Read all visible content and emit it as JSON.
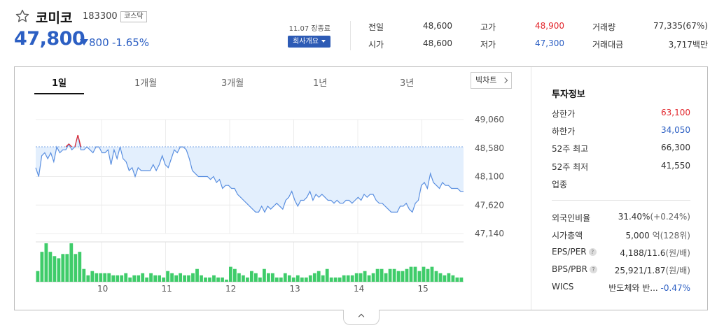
{
  "stock": {
    "name": "코미코",
    "code": "183300",
    "market": "코스닥",
    "price": "47,800",
    "change_amount": "800",
    "change_rate": "-1.65%",
    "date_close": "11.07 장종료",
    "company_button": "회사개요"
  },
  "quote": {
    "prev_close_label": "전일",
    "prev_close": "48,600",
    "high_label": "고가",
    "high": "48,900",
    "volume_label": "거래량",
    "volume": "77,335(67%)",
    "open_label": "시가",
    "open": "48,600",
    "low_label": "저가",
    "low": "47,300",
    "trade_value_label": "거래대금",
    "trade_value": "3,717백만"
  },
  "tabs": [
    {
      "label": "1일",
      "active": true
    },
    {
      "label": "1개월",
      "active": false
    },
    {
      "label": "3개월",
      "active": false
    },
    {
      "label": "1년",
      "active": false
    },
    {
      "label": "3년",
      "active": false
    }
  ],
  "big_chart_label": "빅차트",
  "colors": {
    "up": "#e2262c",
    "down": "#2c5fc3",
    "line": "#5a8fe0",
    "fill": "#e3effd",
    "volume": "#3fcc6a"
  },
  "chart_data": {
    "type": "area",
    "y_ticks": [
      "49,060",
      "48,580",
      "48,100",
      "47,620",
      "47,140"
    ],
    "ylim": [
      47140,
      49060
    ],
    "prev_close": 48600,
    "x_ticks": [
      "10",
      "11",
      "12",
      "13",
      "14",
      "15"
    ],
    "price_series": [
      48250,
      48100,
      48450,
      48500,
      48400,
      48500,
      48350,
      48600,
      48500,
      48550,
      48550,
      48650,
      48550,
      48600,
      48800,
      48550,
      48550,
      48600,
      48550,
      48500,
      48600,
      48600,
      48500,
      48500,
      48550,
      48300,
      48550,
      48400,
      48600,
      48400,
      48350,
      48200,
      48250,
      48100,
      48250,
      48200,
      48200,
      48200,
      48200,
      48300,
      48200,
      48300,
      48450,
      48300,
      48250,
      48400,
      48550,
      48500,
      48600,
      48600,
      48550,
      48400,
      48200,
      48150,
      48100,
      48100,
      48100,
      48100,
      48050,
      48100,
      48000,
      48050,
      47900,
      47950,
      47950,
      47900,
      47900,
      47800,
      47750,
      47700,
      47650,
      47600,
      47550,
      47500,
      47500,
      47600,
      47500,
      47600,
      47550,
      47600,
      47650,
      47600,
      47550,
      47700,
      47750,
      47850,
      47700,
      47600,
      47700,
      47700,
      47750,
      47850,
      47700,
      47800,
      47750,
      47800,
      47750,
      47700,
      47700,
      47650,
      47700,
      47650,
      47650,
      47700,
      47700,
      47650,
      47700,
      47750,
      47700,
      47800,
      47750,
      47800,
      47800,
      47700,
      47650,
      47650,
      47600,
      47550,
      47500,
      47500,
      47500,
      47600,
      47600,
      47650,
      47550,
      47500,
      47650,
      47700,
      47950,
      48000,
      47900,
      48150,
      48000,
      47950,
      47900,
      48000,
      47950,
      47950,
      47900,
      47900,
      47900,
      47850,
      47850
    ],
    "volume_series": [
      5,
      14,
      18,
      14,
      12,
      11,
      13,
      13,
      18,
      13,
      14,
      6,
      3,
      5,
      4,
      4,
      4,
      4,
      3,
      3,
      3,
      4,
      2,
      3,
      3,
      4,
      2,
      4,
      3,
      3,
      2,
      5,
      4,
      3,
      4,
      3,
      3,
      4,
      6,
      3,
      2,
      2,
      3,
      2,
      2,
      1,
      7,
      6,
      4,
      3,
      2,
      5,
      4,
      2,
      6,
      4,
      4,
      2,
      2,
      4,
      3,
      2,
      3,
      2,
      2,
      3,
      4,
      5,
      3,
      6,
      2,
      2,
      2,
      3,
      3,
      3,
      4,
      4,
      5,
      3,
      4,
      6,
      6,
      4,
      6,
      6,
      5,
      5,
      6,
      7,
      7,
      5,
      7,
      6,
      7,
      5,
      4,
      3,
      4,
      3,
      2,
      2
    ]
  },
  "investment": {
    "title": "투자정보",
    "upper_limit_label": "상한가",
    "upper_limit": "63,100",
    "lower_limit_label": "하한가",
    "lower_limit": "34,050",
    "week52_high_label": "52주 최고",
    "week52_high": "66,300",
    "week52_low_label": "52주 최저",
    "week52_low": "41,550",
    "industry_label": "업종",
    "foreign_label": "외국인비율",
    "foreign_value": "31.40%",
    "foreign_change": "(+0.24%)",
    "market_cap_label": "시가총액",
    "market_cap_value": "5,000",
    "market_cap_unit": "억(128위)",
    "eps_per_label": "EPS/PER",
    "eps_per_value": "4,188/11.6",
    "eps_per_unit": "(원/배)",
    "bps_pbr_label": "BPS/PBR",
    "bps_pbr_value": "25,921/1.87",
    "bps_pbr_unit": "(원/배)",
    "wics_label": "WICS",
    "wics_value": "반도체와 반...",
    "wics_change": "-0.47%"
  }
}
